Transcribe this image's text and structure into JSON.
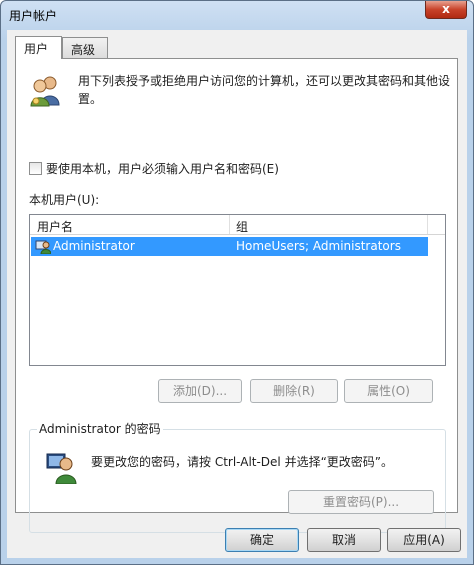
{
  "window": {
    "title": "用户帐户",
    "close_label": "x"
  },
  "tabs": [
    {
      "label": "用户"
    },
    {
      "label": "高级"
    }
  ],
  "intro_text": "用下列表授予或拒绝用户访问您的计算机，还可以更改其密码和其他设置。",
  "require_login": {
    "label": "要使用本机，用户必须输入用户名和密码(E)",
    "checked": false
  },
  "users_list": {
    "label": "本机用户(U):",
    "columns": [
      "用户名",
      "组"
    ],
    "rows": [
      {
        "username": "Administrator",
        "group": "HomeUsers; Administrators",
        "selected": true
      }
    ]
  },
  "list_buttons": {
    "add": "添加(D)...",
    "remove": "删除(R)",
    "properties": "属性(O)"
  },
  "password_group": {
    "title": "Administrator 的密码",
    "text": "要更改您的密码，请按 Ctrl-Alt-Del 并选择“更改密码”。",
    "reset_button": "重置密码(P)..."
  },
  "dialog_buttons": {
    "ok": "确定",
    "cancel": "取消",
    "apply": "应用(A)"
  },
  "colors": {
    "selection": "#3399ff",
    "title_bar": "#b9d1ea",
    "close": "#c8432a"
  }
}
